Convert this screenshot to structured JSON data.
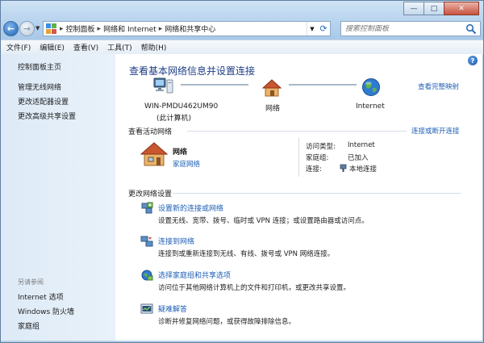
{
  "window": {
    "minimize": "—",
    "maximize": "□",
    "close": "✕"
  },
  "address": {
    "crumbs": [
      "控制面板",
      "网络和 Internet",
      "网络和共享中心"
    ]
  },
  "search": {
    "placeholder": "搜索控制面板"
  },
  "menu": [
    "文件(F)",
    "编辑(E)",
    "查看(V)",
    "工具(T)",
    "帮助(H)"
  ],
  "sidebar": {
    "home": "控制面板主页",
    "links": [
      "管理无线网络",
      "更改适配器设置",
      "更改高级共享设置"
    ],
    "see_also_header": "另请参阅",
    "see_also": [
      "Internet 选项",
      "Windows 防火墙",
      "家庭组"
    ]
  },
  "main": {
    "title": "查看基本网络信息并设置连接",
    "full_map_link": "查看完整映射",
    "map": {
      "computer_name": "WIN-PMDU462UM90",
      "computer_sub": "(此计算机)",
      "network": "网络",
      "internet": "Internet"
    },
    "active": {
      "heading": "查看活动网络",
      "connect_link": "连接或断开连接",
      "network_name": "网络",
      "network_type": "家庭网络",
      "access_type_label": "访问类型:",
      "access_type_value": "Internet",
      "homegroup_label": "家庭组:",
      "homegroup_value": "已加入",
      "connection_label": "连接:",
      "connection_value": "本地连接"
    },
    "change": {
      "heading": "更改网络设置",
      "tasks": [
        {
          "title": "设置新的连接或网络",
          "desc": "设置无线、宽带、拨号、临时或 VPN 连接；或设置路由器或访问点。",
          "icon": "new-connection-icon"
        },
        {
          "title": "连接到网络",
          "desc": "连接到或重新连接到无线、有线、拨号或 VPN 网络连接。",
          "icon": "connect-network-icon"
        },
        {
          "title": "选择家庭组和共享选项",
          "desc": "访问位于其他网络计算机上的文件和打印机，或更改共享设置。",
          "icon": "homegroup-icon"
        },
        {
          "title": "疑难解答",
          "desc": "诊断并修复网络问题，或获得故障排除信息。",
          "icon": "troubleshoot-icon"
        }
      ]
    }
  },
  "colors": {
    "link": "#1f5fb5",
    "title": "#1e3d86",
    "accent": "#2d6db5"
  }
}
